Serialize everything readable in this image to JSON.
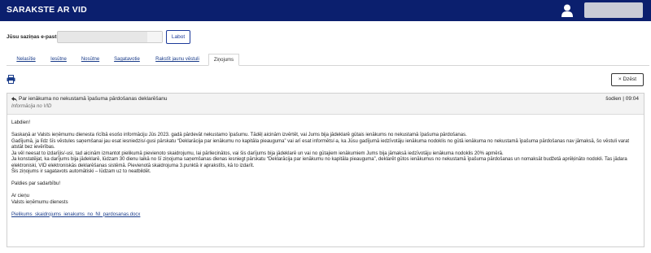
{
  "app": {
    "title": "SARAKSTE AR VID"
  },
  "email": {
    "label": "Jūsu saziņas e-pasts",
    "value": "",
    "button_label": "Labot"
  },
  "tabs": [
    {
      "label": "Nelasītie"
    },
    {
      "label": "Iesūtne"
    },
    {
      "label": "Nosūtne"
    },
    {
      "label": "Sagatavotie"
    },
    {
      "label": "Rakstīt jaunu vēstuli"
    },
    {
      "label": "Ziņojums"
    }
  ],
  "toolbar": {
    "delete_label": "× Dzēst"
  },
  "message": {
    "subject": "Par ienākuma no nekustamā īpašuma pārdošanas deklarēšanu",
    "sender": "Informācija no VID",
    "date": "šodien | 09:04",
    "greeting": "Labdien!",
    "paragraph1": [
      "Saskaņā ar Valsts ieņēmumu dienesta rīcībā esošo informāciju Jūs 2023. gadā pārdevāt nekustamo īpašumu. Tādēļ aicinām izvērtēt, vai Jums bija jādeklarē gūtais ienākums no nekustamā īpašuma pārdošanas.",
      "Gadījumā, ja līdz šīs vēstules saņemšanai jau esat iesniedzis/-gusi pārskatu “Deklarācija par ienākumu no kapitāla pieauguma” vai arī esat informēts/-a, ka Jūsu gadījumā iedzīvotāju ienākuma nodoklis no gūtā ienākuma no nekustamā īpašuma pārdošanas nav jāmaksā, šo vēstuli varat atstāt bez ievērības.",
      "Ja vēl neesat to izdarījis/-usi, tad aicinām izmantot pielikumā pievienoto skaidrojumu, lai pārliecinātos, vai šis darījums bija jādeklarē un vai no gūtajiem ienākumiem Jums bija jāmaksā iedzīvotāju ienākuma nodoklis 20% apmērā.",
      "Ja konstatējat, ka darījums bija jādeklarē, lūdzam 30 dienu laikā no šī ziņojuma saņemšanas dienas iesniegt pārskatu “Deklarācija par ienākumu no kapitāla pieauguma”, deklarēt gūtos ienākumus no nekustamā īpašuma pārdošanas un nomaksāt budžetā aprēķināto nodokli. Tas jādara elektroniski, VID elektroniskās deklarēšanas sistēmā. Pievienotā skaidrojuma 3.punktā ir aprakstīts, kā to izdarīt.",
      "Šis ziņojums ir sagatavots automātiski – lūdzam uz to neatbildēt."
    ],
    "thanks": "Paldies par sadarbību!",
    "closing1": "Ar cieņu",
    "closing2": "Valsts ieņēmumu dienests",
    "attachment": "Pielikums_skaidrojums_ienakums_no_NI_pardosanas.docx"
  },
  "colors": {
    "header_bg": "#0b1f6e",
    "link": "#1a3c8a",
    "button_border": "#1c3a9a"
  },
  "icons": {
    "user": "user-icon",
    "print": "printer-icon",
    "reply": "reply-icon"
  }
}
